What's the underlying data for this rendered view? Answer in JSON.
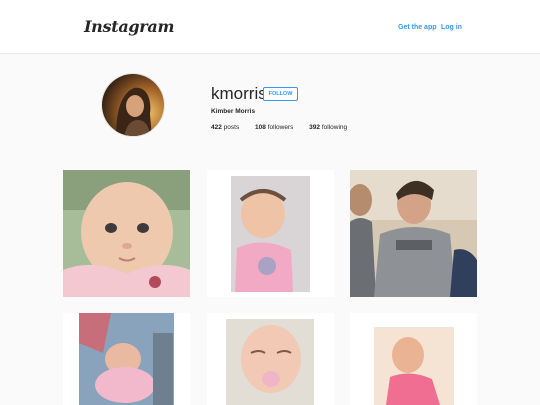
{
  "header": {
    "logo_text": "Instagram",
    "get_app_label": "Get the app",
    "login_label": "Log in"
  },
  "profile": {
    "username": "kmorris",
    "follow_label": "FOLLOW",
    "full_name": "Kimber Morris",
    "posts_count": "422",
    "posts_label": "posts",
    "followers_count": "108",
    "followers_label": "followers",
    "following_count": "392",
    "following_label": "following"
  },
  "colors": {
    "accent": "#3897f0",
    "background": "#fafafa"
  }
}
